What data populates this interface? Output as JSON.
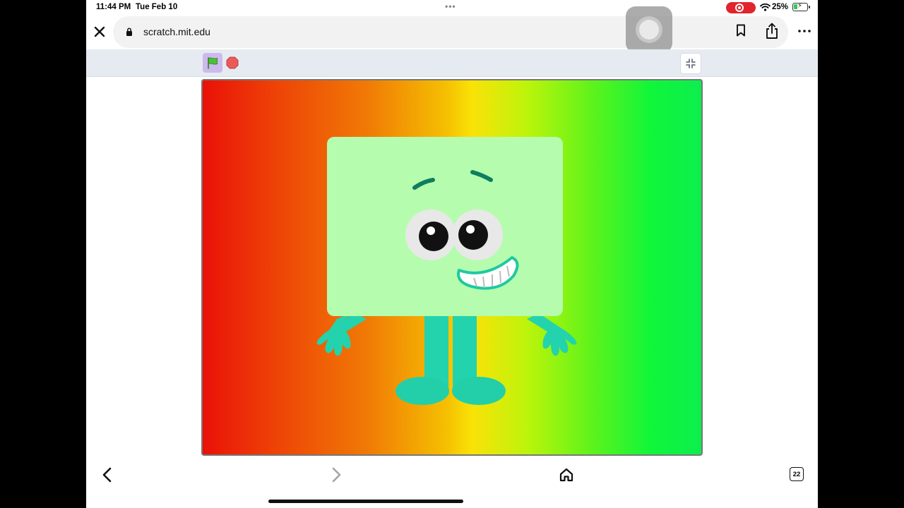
{
  "status_bar": {
    "time": "11:44 PM",
    "date": "Tue Feb 10",
    "multitask": "•••",
    "battery_percent": "25%",
    "battery_level": 0.25,
    "charging": true,
    "screen_recording": true
  },
  "browser": {
    "url": "scratch.mit.edu",
    "icons": {
      "close": "close-icon",
      "lock": "lock-icon",
      "bookmark": "bookmark-icon",
      "share": "share-icon",
      "more": "more-icon"
    }
  },
  "scratch": {
    "controls": {
      "green_flag": "green-flag-icon",
      "stop": "stop-icon",
      "unfullscreen": "unfullscreen-icon"
    },
    "stage": {
      "background_colors": [
        "#ea1108",
        "#f07a05",
        "#fae207",
        "#5ef31b",
        "#0dee4e"
      ],
      "sprite": "smiling-rectangle-character",
      "sprite_colors": {
        "body": "#b6fcaf",
        "limbs": "#23d3ad"
      }
    }
  },
  "toolbar": {
    "tab_count": "22",
    "icons": {
      "back": "chevron-left-icon",
      "forward": "chevron-right-icon",
      "home": "home-icon"
    }
  }
}
